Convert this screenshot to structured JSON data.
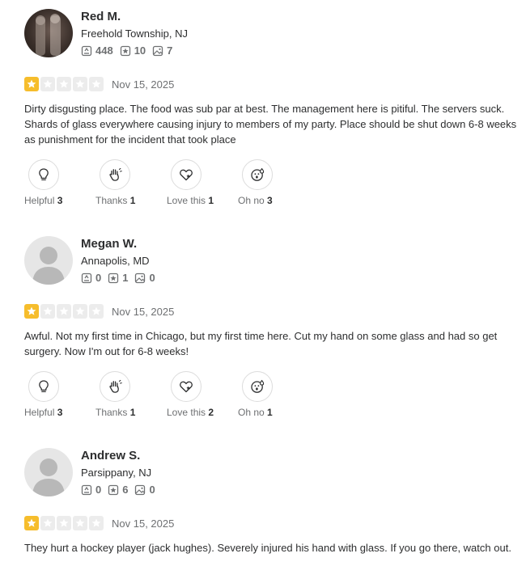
{
  "colors": {
    "star_active": "#f6bd2c",
    "star_inactive": "#ececec",
    "muted": "#6e7072",
    "text": "#2d2e2f"
  },
  "reviews": [
    {
      "name": "Red M.",
      "location": "Freehold Township, NJ",
      "avatar": "user-photo",
      "stats": {
        "reviews": "448",
        "friends": "10",
        "photos": "7"
      },
      "rating": 1,
      "date": "Nov 15, 2025",
      "text": "Dirty disgusting place. The food was sub par at best. The management here is pitiful. The servers suck. Shards of glass everywhere causing injury to members of my party. Place should be shut down 6-8 weeks as punishment for the incident that took place",
      "reactions": [
        {
          "label": "Helpful",
          "count": "3",
          "icon": "lightbulb-icon"
        },
        {
          "label": "Thanks",
          "count": "1",
          "icon": "waving-hand-icon"
        },
        {
          "label": "Love this",
          "count": "1",
          "icon": "heart-icon"
        },
        {
          "label": "Oh no",
          "count": "3",
          "icon": "shocked-face-icon"
        }
      ]
    },
    {
      "name": "Megan W.",
      "location": "Annapolis, MD",
      "avatar": "default-avatar",
      "stats": {
        "reviews": "0",
        "friends": "1",
        "photos": "0"
      },
      "rating": 1,
      "date": "Nov 15, 2025",
      "text": "Awful. Not my first time in Chicago, but my first time here. Cut my hand on some glass and had so get surgery. Now I'm out for 6-8 weeks!",
      "reactions": [
        {
          "label": "Helpful",
          "count": "3",
          "icon": "lightbulb-icon"
        },
        {
          "label": "Thanks",
          "count": "1",
          "icon": "waving-hand-icon"
        },
        {
          "label": "Love this",
          "count": "2",
          "icon": "heart-icon"
        },
        {
          "label": "Oh no",
          "count": "1",
          "icon": "shocked-face-icon"
        }
      ]
    },
    {
      "name": "Andrew S.",
      "location": "Parsippany, NJ",
      "avatar": "default-avatar",
      "stats": {
        "reviews": "0",
        "friends": "6",
        "photos": "0"
      },
      "rating": 1,
      "date": "Nov 15, 2025",
      "text": "They hurt a hockey player (jack hughes). Severely injured his hand with glass. If you go there, watch out."
    }
  ]
}
